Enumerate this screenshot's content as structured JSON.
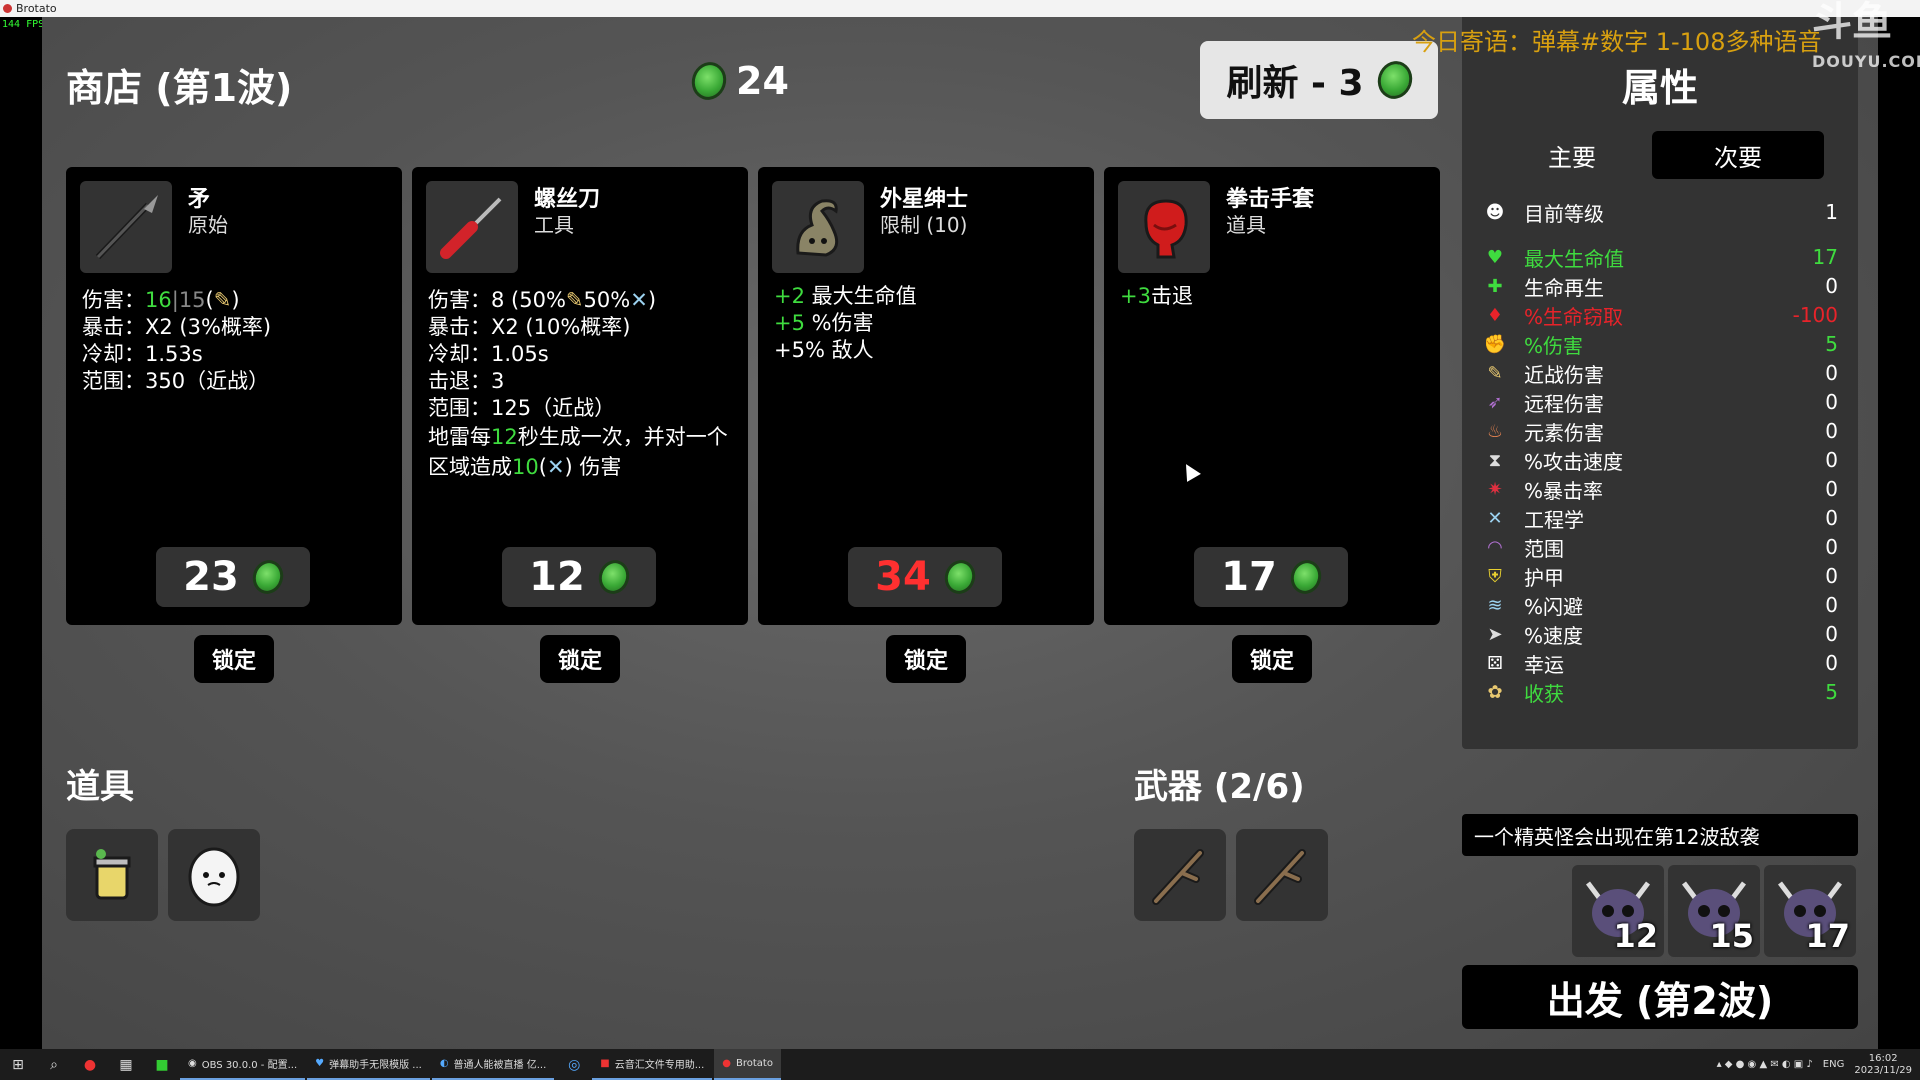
{
  "window": {
    "title": "Brotato",
    "fps": "144 FPS"
  },
  "overlay": {
    "message": "今日寄语：弹幕#数字 1-108多种语音",
    "watermark": "斗鱼",
    "watermark_sub": "DOUYU.COM"
  },
  "shop": {
    "title": "商店 (第1波)",
    "gold": "24",
    "reroll_label": "刷新 - 3"
  },
  "cards": [
    {
      "name": "矛",
      "type": "原始",
      "icon": "spear-icon",
      "price": "23",
      "price_color": "#ffffff",
      "lock_label": "锁定",
      "stats": {
        "dmg_label": "伤害：",
        "dmg_val": "16",
        "dmg_sep": "|",
        "dmg_base": "15",
        "dmg_suffix": "(",
        "dmg_close": ")",
        "crit": "暴击：X2 (3%概率)",
        "cooldown": "冷却：1.53s",
        "range": "范围：350（近战）"
      }
    },
    {
      "name": "螺丝刀",
      "type": "工具",
      "icon": "screwdriver-icon",
      "price": "12",
      "price_color": "#ffffff",
      "lock_label": "锁定",
      "stats": {
        "dmg": "伤害：8 (50%",
        "dmg_mid": "50%",
        "dmg_close": ")",
        "crit": "暴击：X2 (10%概率)",
        "cooldown": "冷却：1.05s",
        "knockback": "击退：3",
        "range": "范围：125（近战）",
        "mine_a": "地雷每",
        "mine_sec": "12",
        "mine_b": "秒生成一次，并对一个区域造成",
        "mine_dmg": "10",
        "mine_c": "(",
        "mine_d": ") 伤害"
      }
    },
    {
      "name": "外星绅士",
      "type": "限制 (10)",
      "icon": "alien-gentleman-icon",
      "price": "34",
      "price_color": "#ff3030",
      "lock_label": "锁定",
      "stats": {
        "hp_val": "+2",
        "hp_txt": " 最大生命值",
        "dmg_val": "+5",
        "dmg_txt": " %伤害",
        "enemy": "+5% 敌人"
      }
    },
    {
      "name": "拳击手套",
      "type": "道具",
      "icon": "boxing-glove-icon",
      "price": "17",
      "price_color": "#ffffff",
      "lock_label": "锁定",
      "stats": {
        "kb_val": "+3",
        "kb_txt": "击退"
      }
    }
  ],
  "inventory": {
    "items_title": "道具",
    "items": [
      {
        "icon": "cup-icon"
      },
      {
        "icon": "egg-face-icon"
      }
    ],
    "weapons_title": "武器 (2/6)",
    "weapons": [
      {
        "icon": "stick-icon"
      },
      {
        "icon": "stick-icon"
      }
    ]
  },
  "stats_panel": {
    "title": "属性",
    "tab_primary": "主要",
    "tab_secondary": "次要",
    "level_label": "目前等级",
    "level_value": "1",
    "rows": [
      {
        "label": "最大生命值",
        "value": "17",
        "color": "green",
        "icon": "heart-icon"
      },
      {
        "label": "生命再生",
        "value": "0",
        "color": "white",
        "icon": "regen-icon"
      },
      {
        "label": "%生命窃取",
        "value": "-100",
        "color": "red",
        "icon": "lifesteal-icon"
      },
      {
        "label": "%伤害",
        "value": "5",
        "color": "green",
        "icon": "damage-icon"
      },
      {
        "label": "近战伤害",
        "value": "0",
        "color": "white",
        "icon": "melee-icon"
      },
      {
        "label": "远程伤害",
        "value": "0",
        "color": "white",
        "icon": "ranged-icon"
      },
      {
        "label": "元素伤害",
        "value": "0",
        "color": "white",
        "icon": "elemental-icon"
      },
      {
        "label": "%攻击速度",
        "value": "0",
        "color": "white",
        "icon": "attack-speed-icon"
      },
      {
        "label": "%暴击率",
        "value": "0",
        "color": "white",
        "icon": "crit-icon"
      },
      {
        "label": "工程学",
        "value": "0",
        "color": "white",
        "icon": "engineering-icon"
      },
      {
        "label": "范围",
        "value": "0",
        "color": "white",
        "icon": "range-icon"
      },
      {
        "label": "护甲",
        "value": "0",
        "color": "white",
        "icon": "armor-icon"
      },
      {
        "label": "%闪避",
        "value": "0",
        "color": "white",
        "icon": "dodge-icon"
      },
      {
        "label": "%速度",
        "value": "0",
        "color": "white",
        "icon": "speed-icon"
      },
      {
        "label": "幸运",
        "value": "0",
        "color": "white",
        "icon": "luck-icon"
      },
      {
        "label": "收获",
        "value": "5",
        "color": "green",
        "icon": "harvest-icon"
      }
    ]
  },
  "elite": {
    "message": "一个精英怪会出现在第12波敌袭",
    "waves": [
      "12",
      "15",
      "17"
    ]
  },
  "go_button": "出发 (第2波)",
  "taskbar": {
    "apps": [
      {
        "label": "OBS 30.0.0 - 配置..."
      },
      {
        "label": "弹幕助手无限模版 ..."
      },
      {
        "label": "普通人能被直播 亿..."
      },
      {
        "label": "云音汇文件专用助..."
      },
      {
        "label": "Brotato"
      }
    ],
    "lang": "ENG",
    "time": "16:02",
    "date": "2023/11/29"
  }
}
